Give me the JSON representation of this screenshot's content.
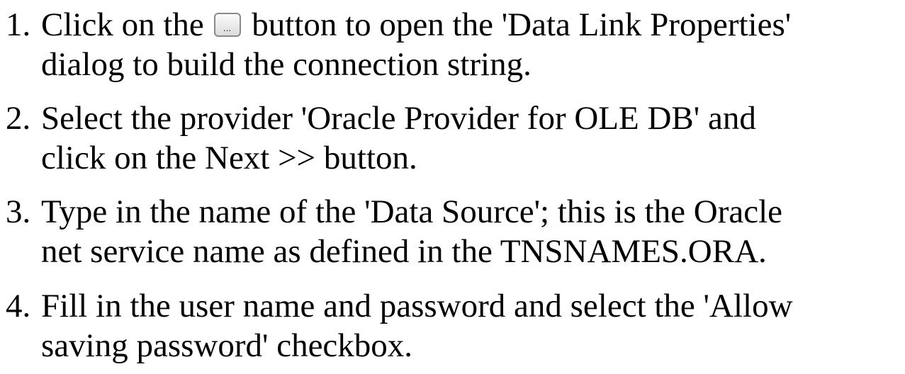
{
  "steps": [
    {
      "number": "1.",
      "line1_before": "Click on the",
      "line1_after": "button to open the 'Data Link Properties'",
      "line2": "dialog to build the connection string.",
      "button_glyph": "..."
    },
    {
      "number": "2.",
      "line1": "Select the provider 'Oracle Provider for OLE DB' and",
      "line2": "click on the Next >> button."
    },
    {
      "number": "3.",
      "line1": "Type in the name of the 'Data Source'; this is the Oracle",
      "line2": "net service name as defined in the TNSNAMES.ORA."
    },
    {
      "number": "4.",
      "line1": "Fill in the user name and password and select the 'Allow",
      "line2": "saving password' checkbox."
    }
  ],
  "icons": {
    "ellipsis_button": "ellipsis-button-icon"
  }
}
